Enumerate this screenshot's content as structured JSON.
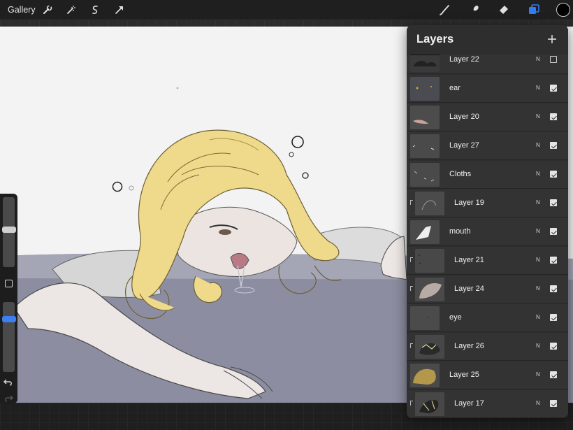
{
  "toolbar": {
    "gallery_label": "Gallery",
    "left_icons": [
      "wrench-icon",
      "magic-wand-icon",
      "selection-icon",
      "transform-arrow-icon"
    ],
    "right_icons": [
      "brush-icon",
      "smudge-icon",
      "eraser-icon",
      "layers-icon"
    ],
    "active_tool": "layers",
    "current_color": "#000000",
    "accent_color": "#2f7ef5"
  },
  "sidebar": {
    "brush_size_level": 0.72,
    "opacity_level": 0.85
  },
  "layers": {
    "title": "Layers",
    "add_icon": "plus-icon",
    "items": [
      {
        "name": "Layer 22",
        "blend": "N",
        "visible": false,
        "clipped": false
      },
      {
        "name": "ear",
        "blend": "N",
        "visible": true,
        "clipped": false
      },
      {
        "name": "Layer 20",
        "blend": "N",
        "visible": true,
        "clipped": false
      },
      {
        "name": "Layer 27",
        "blend": "N",
        "visible": true,
        "clipped": false
      },
      {
        "name": "Cloths",
        "blend": "N",
        "visible": true,
        "clipped": false
      },
      {
        "name": "Layer 19",
        "blend": "N",
        "visible": true,
        "clipped": true
      },
      {
        "name": "mouth",
        "blend": "N",
        "visible": true,
        "clipped": false
      },
      {
        "name": "Layer 21",
        "blend": "N",
        "visible": true,
        "clipped": true
      },
      {
        "name": "Layer 24",
        "blend": "N",
        "visible": true,
        "clipped": true
      },
      {
        "name": "eye",
        "blend": "N",
        "visible": true,
        "clipped": false
      },
      {
        "name": "Layer 26",
        "blend": "N",
        "visible": true,
        "clipped": true
      },
      {
        "name": "Layer 25",
        "blend": "N",
        "visible": true,
        "clipped": false
      },
      {
        "name": "Layer 17",
        "blend": "N",
        "visible": true,
        "clipped": true
      }
    ]
  }
}
